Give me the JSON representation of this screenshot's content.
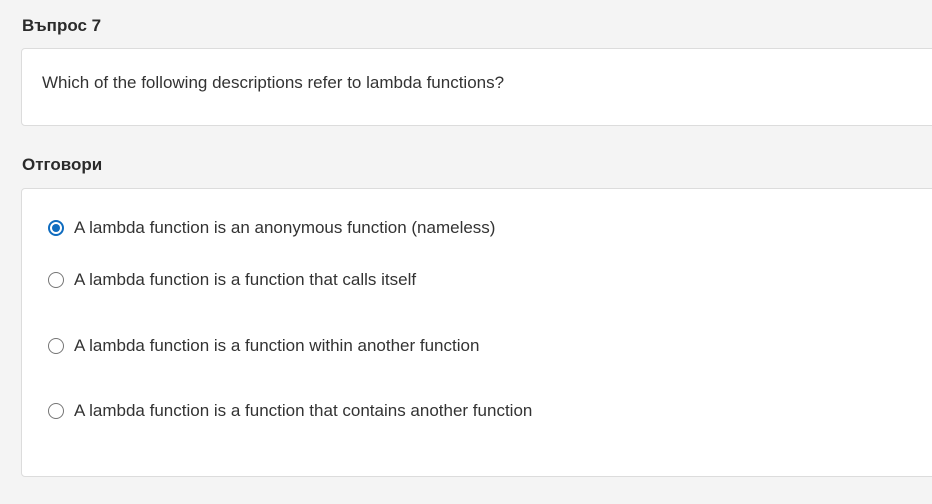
{
  "question": {
    "heading": "Въпрос 7",
    "text": "Which of the following descriptions refer to lambda functions?"
  },
  "answers": {
    "heading": "Отговори",
    "selected_index": 0,
    "options": [
      {
        "label": "A lambda function is an anonymous function (nameless)",
        "selected": true
      },
      {
        "label": "A lambda function is a function that calls itself",
        "selected": false
      },
      {
        "label": "A lambda function is a function within another function",
        "selected": false
      },
      {
        "label": "A lambda function is a function that contains another function",
        "selected": false
      }
    ]
  },
  "colors": {
    "background": "#f4f4f4",
    "card": "#ffffff",
    "border": "#dcdcdc",
    "accent": "#0f6cbf",
    "text": "#333333"
  }
}
